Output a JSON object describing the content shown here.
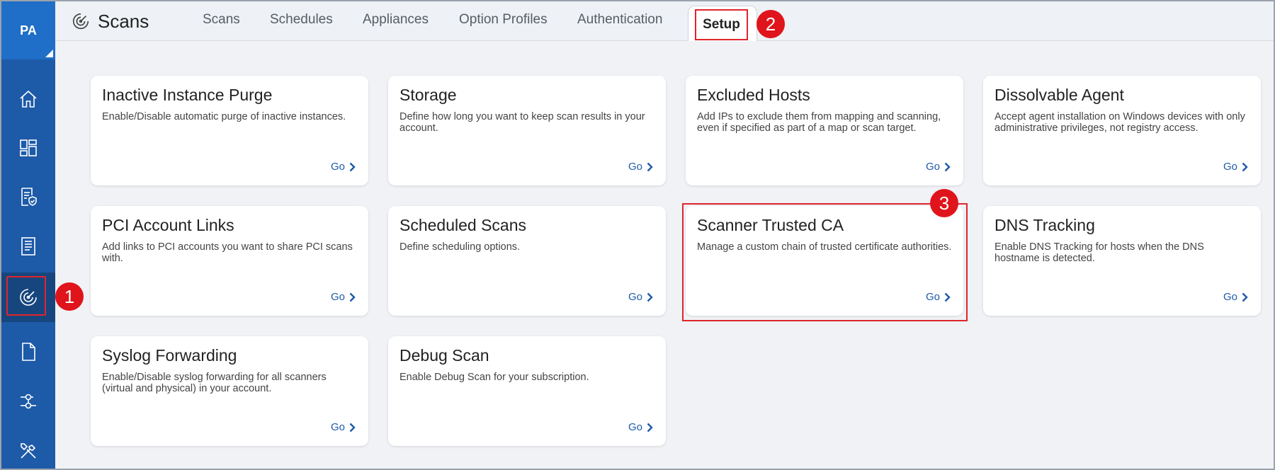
{
  "sidebar": {
    "avatar": "PA",
    "items": [
      {
        "name": "home-icon"
      },
      {
        "name": "dashboard-icon"
      },
      {
        "name": "policy-shield-icon"
      },
      {
        "name": "report-icon"
      },
      {
        "name": "scans-radar-icon",
        "active": true
      },
      {
        "name": "document-icon"
      },
      {
        "name": "connectors-icon"
      },
      {
        "name": "tools-icon"
      }
    ]
  },
  "header": {
    "title": "Scans",
    "tabs": [
      "Scans",
      "Schedules",
      "Appliances",
      "Option Profiles",
      "Authentication",
      "Setup"
    ],
    "active_tab": "Setup"
  },
  "steps": [
    "1",
    "2",
    "3"
  ],
  "cards": [
    {
      "title": "Inactive Instance Purge",
      "desc": "Enable/Disable automatic purge of inactive instances.",
      "go": "Go"
    },
    {
      "title": "Storage",
      "desc": "Define how long you want to keep scan results in your account.",
      "go": "Go"
    },
    {
      "title": "Excluded Hosts",
      "desc": "Add IPs to exclude them from mapping and scanning, even if specified as part of a map or scan target.",
      "go": "Go"
    },
    {
      "title": "Dissolvable Agent",
      "desc": "Accept agent installation on Windows devices with only administrative privileges, not registry access.",
      "go": "Go"
    },
    {
      "title": "PCI Account Links",
      "desc": "Add links to PCI accounts you want to share PCI scans with.",
      "go": "Go"
    },
    {
      "title": "Scheduled Scans",
      "desc": "Define scheduling options.",
      "go": "Go"
    },
    {
      "title": "Scanner Trusted CA",
      "desc": "Manage a custom chain of trusted certificate authorities.",
      "go": "Go"
    },
    {
      "title": "DNS Tracking",
      "desc": "Enable DNS Tracking for hosts when the DNS hostname is detected.",
      "go": "Go"
    },
    {
      "title": "Syslog Forwarding",
      "desc": "Enable/Disable syslog forwarding for all scanners (virtual and physical) in your account.",
      "go": "Go"
    },
    {
      "title": "Debug Scan",
      "desc": "Enable Debug Scan for your subscription.",
      "go": "Go"
    }
  ],
  "colors": {
    "sidebar": "#1d5aa8",
    "accent": "#1d5aa8",
    "highlight": "#e0242b",
    "badge": "#e0141b",
    "background": "#f0f2f5"
  }
}
